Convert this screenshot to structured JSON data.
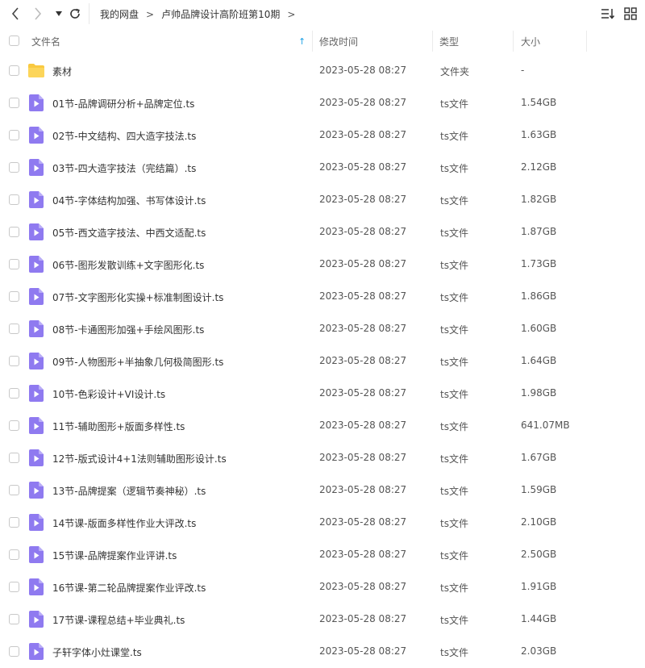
{
  "breadcrumb": {
    "root": "我的网盘",
    "separator": ">",
    "current": "卢帅品牌设计高阶班第10期"
  },
  "columns": {
    "name": "文件名",
    "modified": "修改时间",
    "type": "类型",
    "size": "大小",
    "sort_indicator": "↑"
  },
  "colors": {
    "folder": "#f9c940",
    "video": "#8f7af0",
    "sort_arrow": "#1fa1e5"
  },
  "files": [
    {
      "name": "素材",
      "modified": "2023-05-28 08:27",
      "type": "文件夹",
      "size": "-",
      "icon": "folder-icon"
    },
    {
      "name": "01节-品牌调研分析+品牌定位.ts",
      "modified": "2023-05-28 08:27",
      "type": "ts文件",
      "size": "1.54GB",
      "icon": "video-file-icon"
    },
    {
      "name": "02节-中文结构、四大造字技法.ts",
      "modified": "2023-05-28 08:27",
      "type": "ts文件",
      "size": "1.63GB",
      "icon": "video-file-icon"
    },
    {
      "name": "03节-四大造字技法（完结篇）.ts",
      "modified": "2023-05-28 08:27",
      "type": "ts文件",
      "size": "2.12GB",
      "icon": "video-file-icon"
    },
    {
      "name": "04节-字体结构加强、书写体设计.ts",
      "modified": "2023-05-28 08:27",
      "type": "ts文件",
      "size": "1.82GB",
      "icon": "video-file-icon"
    },
    {
      "name": "05节-西文造字技法、中西文适配.ts",
      "modified": "2023-05-28 08:27",
      "type": "ts文件",
      "size": "1.87GB",
      "icon": "video-file-icon"
    },
    {
      "name": "06节-图形发散训练+文字图形化.ts",
      "modified": "2023-05-28 08:27",
      "type": "ts文件",
      "size": "1.73GB",
      "icon": "video-file-icon"
    },
    {
      "name": "07节-文字图形化实操+标准制图设计.ts",
      "modified": "2023-05-28 08:27",
      "type": "ts文件",
      "size": "1.86GB",
      "icon": "video-file-icon"
    },
    {
      "name": "08节-卡通图形加强+手绘风图形.ts",
      "modified": "2023-05-28 08:27",
      "type": "ts文件",
      "size": "1.60GB",
      "icon": "video-file-icon"
    },
    {
      "name": "09节-人物图形+半抽象几何极简图形.ts",
      "modified": "2023-05-28 08:27",
      "type": "ts文件",
      "size": "1.64GB",
      "icon": "video-file-icon"
    },
    {
      "name": "10节-色彩设计+VI设计.ts",
      "modified": "2023-05-28 08:27",
      "type": "ts文件",
      "size": "1.98GB",
      "icon": "video-file-icon"
    },
    {
      "name": "11节-辅助图形+版面多样性.ts",
      "modified": "2023-05-28 08:27",
      "type": "ts文件",
      "size": "641.07MB",
      "icon": "video-file-icon"
    },
    {
      "name": "12节-版式设计4+1法则辅助图形设计.ts",
      "modified": "2023-05-28 08:27",
      "type": "ts文件",
      "size": "1.67GB",
      "icon": "video-file-icon"
    },
    {
      "name": "13节-品牌提案（逻辑节奏神秘）.ts",
      "modified": "2023-05-28 08:27",
      "type": "ts文件",
      "size": "1.59GB",
      "icon": "video-file-icon"
    },
    {
      "name": "14节课-版面多样性作业大评改.ts",
      "modified": "2023-05-28 08:27",
      "type": "ts文件",
      "size": "2.10GB",
      "icon": "video-file-icon"
    },
    {
      "name": "15节课-品牌提案作业评讲.ts",
      "modified": "2023-05-28 08:27",
      "type": "ts文件",
      "size": "2.50GB",
      "icon": "video-file-icon"
    },
    {
      "name": "16节课-第二轮品牌提案作业评改.ts",
      "modified": "2023-05-28 08:27",
      "type": "ts文件",
      "size": "1.91GB",
      "icon": "video-file-icon"
    },
    {
      "name": "17节课-课程总结+毕业典礼.ts",
      "modified": "2023-05-28 08:27",
      "type": "ts文件",
      "size": "1.44GB",
      "icon": "video-file-icon"
    },
    {
      "name": "子轩字体小灶课堂.ts",
      "modified": "2023-05-28 08:27",
      "type": "ts文件",
      "size": "2.03GB",
      "icon": "video-file-icon"
    }
  ]
}
